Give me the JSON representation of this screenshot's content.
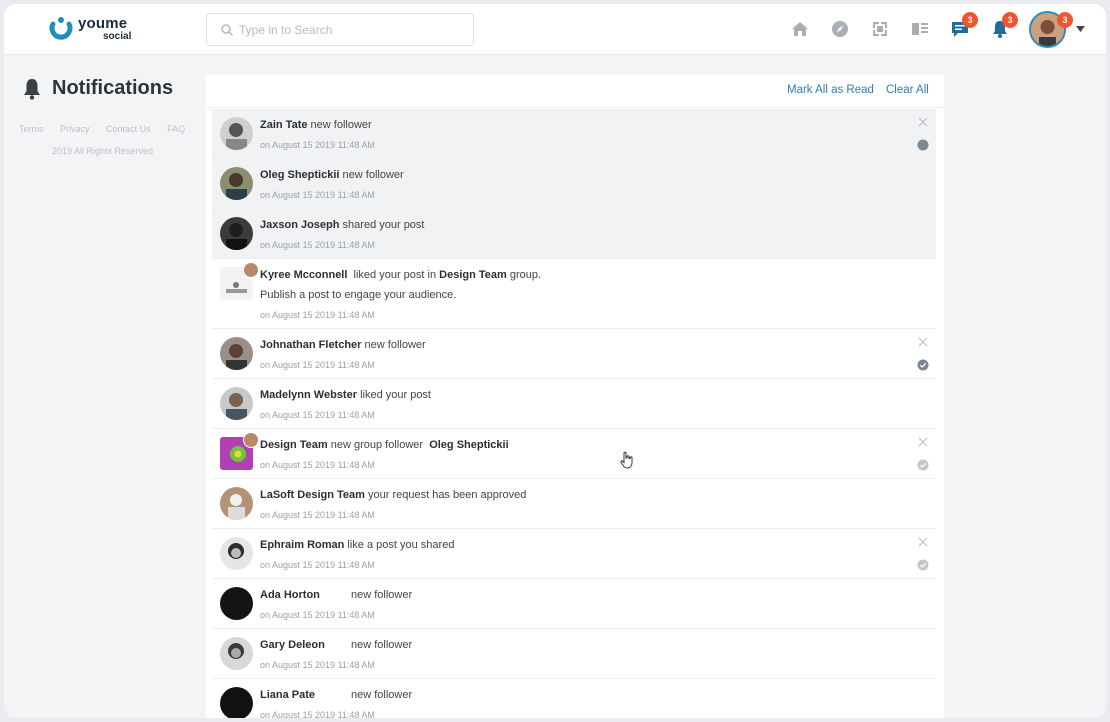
{
  "brand": {
    "name_top": "youme",
    "name_bottom": "social",
    "accent": "#1d8fba"
  },
  "search": {
    "placeholder": "Type in to Search"
  },
  "nav": {
    "icons": [
      "home-icon",
      "compass-icon",
      "groups-icon",
      "pages-icon",
      "chat-icon",
      "bell-icon"
    ],
    "chat_badge": "3",
    "bell_badge": "3",
    "profile_badge": "3"
  },
  "sidebar": {
    "title": "Notifications",
    "links": [
      "Terms",
      "Privacy",
      "Contact Us",
      "FAQ"
    ],
    "copyright": "2019 All Rights Reserved"
  },
  "actions": {
    "mark_all": "Mark All as Read",
    "clear_all": "Clear All"
  },
  "notifications": [
    {
      "name": "Zain Tate",
      "text": "new follower",
      "time": "on August 15 2019 11:48 AM",
      "unread": true
    },
    {
      "name": "Oleg Sheptickii",
      "text": "new follower",
      "time": "on August 15 2019 11:48 AM",
      "unread": true
    },
    {
      "name": "Jaxson Joseph",
      "text": "shared your post",
      "time": "on August 15 2019 11:48 AM",
      "unread": true
    },
    {
      "name": "Kyree Mcconnell",
      "text": "liked your post in",
      "group": "Design Team",
      "text_after": "group.",
      "extra": "Publish a post to engage your audience.",
      "time": "on August 15 2019 11:48 AM"
    },
    {
      "name": "Johnathan Fletcher",
      "text": "new follower",
      "time": "on August 15 2019 11:48 AM"
    },
    {
      "name": "Madelynn Webster",
      "text": "liked your post",
      "time": "on August 15 2019 11:48 AM"
    },
    {
      "name": "Design Team",
      "text": "new group follower",
      "follower": "Oleg Sheptickii",
      "time": "on August 15 2019 11:48 AM"
    },
    {
      "name": "LaSoft Design Team",
      "text": "your request has been approved",
      "time": "on August 15 2019 11:48 AM"
    },
    {
      "name": "Ephraim Roman",
      "text": "like a post you shared",
      "time": "on August 15 2019 11:48 AM"
    },
    {
      "name": "Ada Horton",
      "text": "new follower",
      "time": "on August 15 2019 11:48 AM"
    },
    {
      "name": "Gary Deleon",
      "text": "new follower",
      "time": "on August 15 2019 11:48 AM"
    },
    {
      "name": "Liana Pate",
      "text": "new follower",
      "time": "on August 15 2019 11:48 AM"
    }
  ]
}
